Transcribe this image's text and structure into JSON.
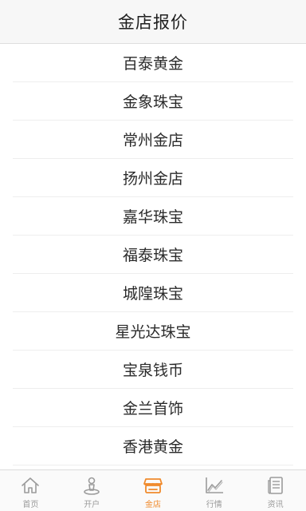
{
  "header": {
    "title": "金店报价"
  },
  "list": {
    "items": [
      "百泰黄金",
      "金象珠宝",
      "常州金店",
      "扬州金店",
      "嘉华珠宝",
      "福泰珠宝",
      "城隍珠宝",
      "星光达珠宝",
      "宝泉钱币",
      "金兰首饰",
      "香港黄金"
    ]
  },
  "tabbar": {
    "active_color": "#f08a2c",
    "inactive_color": "#9b9b9b",
    "tabs": [
      {
        "label": "首页",
        "icon": "home-icon",
        "active": false
      },
      {
        "label": "开户",
        "icon": "person-icon",
        "active": false
      },
      {
        "label": "金店",
        "icon": "store-icon",
        "active": true
      },
      {
        "label": "行情",
        "icon": "chart-icon",
        "active": false
      },
      {
        "label": "资讯",
        "icon": "document-icon",
        "active": false
      }
    ]
  }
}
